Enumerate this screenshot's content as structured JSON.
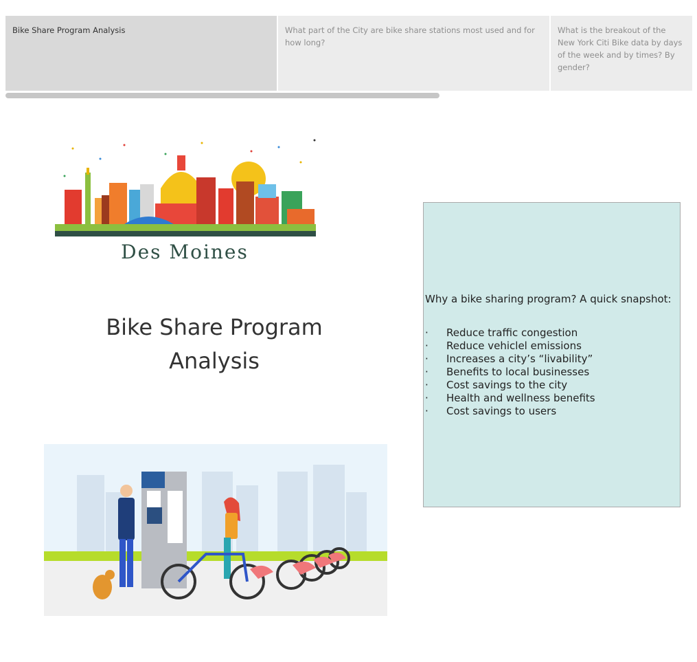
{
  "story_tabs": [
    "Bike Share Program Analysis",
    "What part of the City are bike share stations most used and for how long?",
    "What is the breakout of the New York Citi Bike data by days of the week and by times? By gender?"
  ],
  "skyline_caption": "Des Moines",
  "title": "Bike Share Program Analysis",
  "snapshot": {
    "heading": "Why a bike sharing program?  A quick snapshot:",
    "bullet_char": "·",
    "items": [
      "Reduce traffic congestion",
      "Reduce vehiclel emissions",
      "Increases a city’s “livability”",
      "Benefits to local businesses",
      "Cost savings to the city",
      "Health and wellness benefits",
      "Cost savings to users"
    ]
  },
  "colors": {
    "tab_active": "#d9d9d9",
    "tab_inactive": "#ececec",
    "panel_bg": "#d1eae9",
    "caption": "#2f4f45"
  },
  "illustration_icons": [
    "bike-dock-kiosk-icon",
    "bicycle-icon",
    "dog-icon",
    "person-icon"
  ]
}
